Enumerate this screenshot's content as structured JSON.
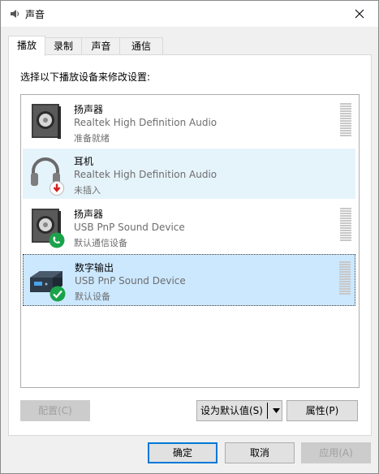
{
  "window": {
    "title": "声音",
    "close_glyph": "×"
  },
  "tabs": [
    {
      "label": "播放"
    },
    {
      "label": "录制"
    },
    {
      "label": "声音"
    },
    {
      "label": "通信"
    }
  ],
  "panel": {
    "instruction": "选择以下播放设备来修改设置:"
  },
  "devices": [
    {
      "name": "扬声器",
      "driver": "Realtek High Definition Audio",
      "status": "准备就绪",
      "icon": "speaker-icon",
      "badge": ""
    },
    {
      "name": "耳机",
      "driver": "Realtek High Definition Audio",
      "status": "未插入",
      "icon": "headphones-icon",
      "badge": "unplugged-badge-icon"
    },
    {
      "name": "扬声器",
      "driver": "USB PnP Sound Device",
      "status": "默认通信设备",
      "icon": "speaker-icon",
      "badge": "default-communication-badge-icon"
    },
    {
      "name": "数字输出",
      "driver": "USB PnP Sound Device",
      "status": "默认设备",
      "icon": "digital-output-icon",
      "badge": "default-device-badge-icon"
    }
  ],
  "buttons": {
    "configure": "配置(C)",
    "set_default": "设为默认值(S)",
    "properties": "属性(P)",
    "ok": "确定",
    "cancel": "取消",
    "apply": "应用(A)"
  },
  "colors": {
    "accent": "#0078d7",
    "selected_bg": "#cce8ff",
    "hover_bg": "#e5f3fb",
    "badge_green": "#1aa34a",
    "badge_red": "#d22020"
  }
}
